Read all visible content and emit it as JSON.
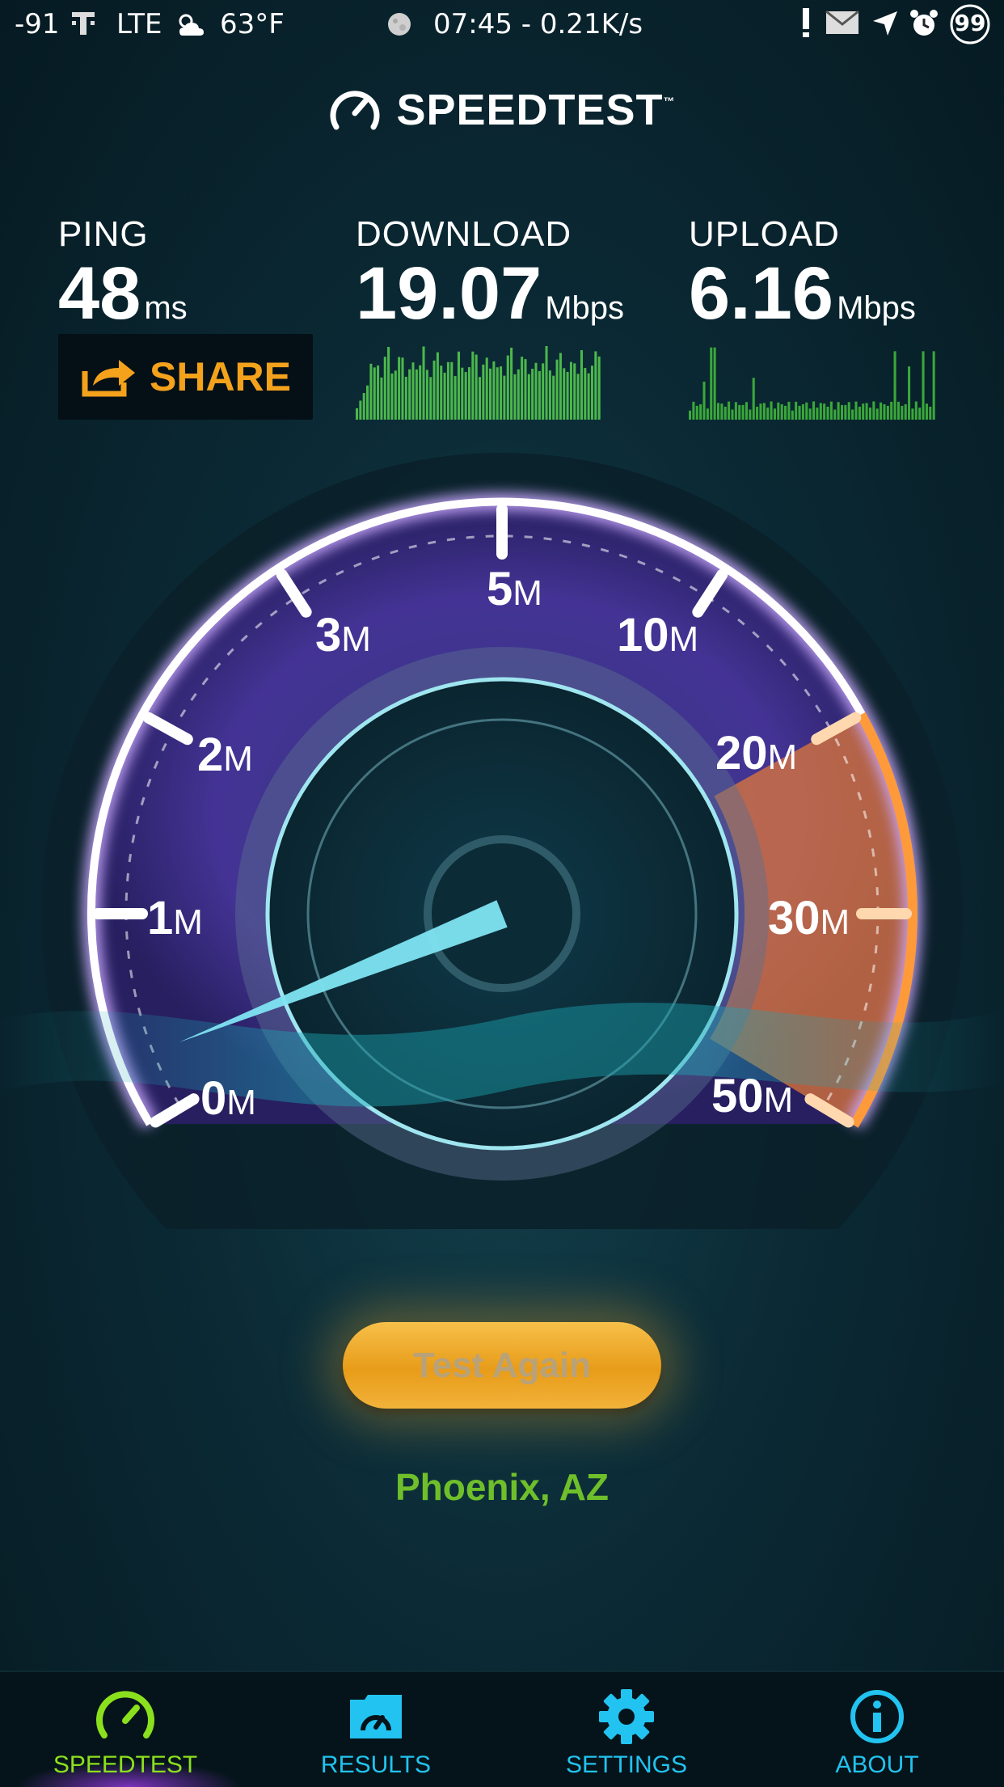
{
  "status_bar": {
    "signal": "-91",
    "carrier_icon": "tmobile-icon",
    "network": "LTE",
    "weather_icon": "partly-cloudy-icon",
    "temperature": "63°F",
    "moon_icon": "moon-icon",
    "time_speed": "07:45 - 0.21K/s",
    "battery": "99"
  },
  "header": {
    "brand": "SPEEDTEST",
    "trademark": "™"
  },
  "stats": {
    "ping": {
      "label": "PING",
      "value": "48",
      "unit": "ms"
    },
    "download": {
      "label": "DOWNLOAD",
      "value": "19.07",
      "unit": "Mbps"
    },
    "upload": {
      "label": "UPLOAD",
      "value": "6.16",
      "unit": "Mbps"
    }
  },
  "share": {
    "label": "SHARE"
  },
  "gauge": {
    "ticks": [
      {
        "num": "0",
        "unit": "M"
      },
      {
        "num": "1",
        "unit": "M"
      },
      {
        "num": "2",
        "unit": "M"
      },
      {
        "num": "3",
        "unit": "M"
      },
      {
        "num": "5",
        "unit": "M"
      },
      {
        "num": "10",
        "unit": "M"
      },
      {
        "num": "20",
        "unit": "M"
      },
      {
        "num": "30",
        "unit": "M"
      },
      {
        "num": "50",
        "unit": "M"
      }
    ],
    "needle_value_mbps": 0.3,
    "accent": "#f08a2a",
    "ring_color": "#a78bfa"
  },
  "actions": {
    "test_again": "Test Again"
  },
  "server": {
    "location": "Phoenix, AZ"
  },
  "nav": {
    "items": [
      {
        "label": "SPEEDTEST",
        "icon": "gauge-icon",
        "active": true
      },
      {
        "label": "RESULTS",
        "icon": "results-icon",
        "active": false
      },
      {
        "label": "SETTINGS",
        "icon": "gear-icon",
        "active": false
      },
      {
        "label": "ABOUT",
        "icon": "info-icon",
        "active": false
      }
    ],
    "active_color": "#8be01e",
    "inactive_color": "#22c3f0"
  }
}
